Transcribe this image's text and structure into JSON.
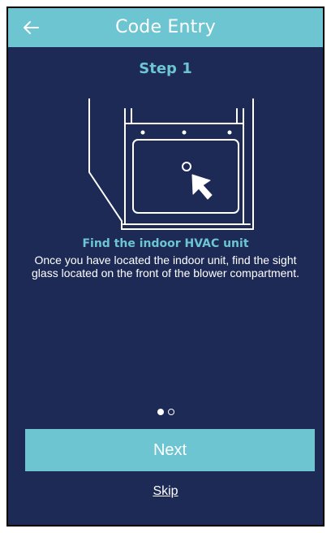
{
  "header": {
    "title": "Code Entry",
    "back_icon": "arrow-left-icon"
  },
  "step": {
    "label": "Step 1"
  },
  "illustration": {
    "icon": "hvac-unit-sight-glass-illustration",
    "pointer_icon": "cursor-arrow-icon"
  },
  "instruction": {
    "title": "Find the indoor HVAC unit",
    "body": "Once you have located the indoor unit, find the sight glass located on the front of the blower compartment."
  },
  "pager": {
    "current": 1,
    "total": 2
  },
  "actions": {
    "next_label": "Next",
    "skip_label": "Skip"
  },
  "colors": {
    "background": "#1d2a56",
    "accent": "#6cc5d0",
    "text": "#ffffff"
  }
}
